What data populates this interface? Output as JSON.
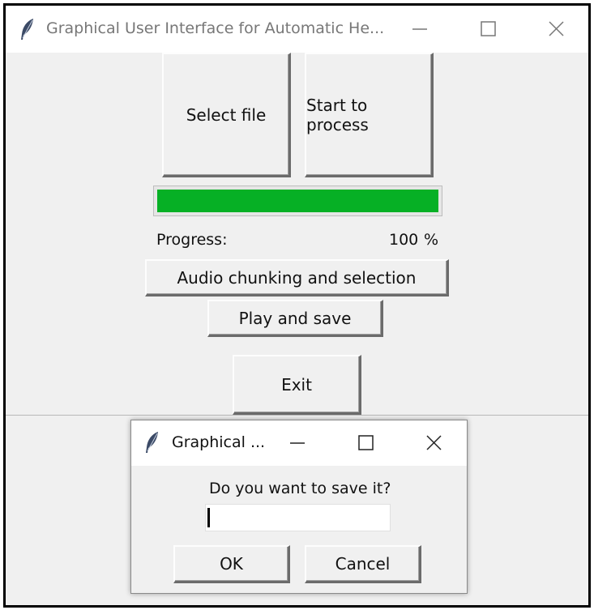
{
  "main_window": {
    "title": "Graphical User Interface for Automatic He...",
    "select_file_label": "Select file",
    "start_process_label": "Start to process",
    "progress": {
      "label": "Progress:",
      "value": 100,
      "value_text": "100",
      "unit": "%"
    },
    "audio_chunking_label": "Audio chunking and selection",
    "play_save_label": "Play and save",
    "exit_label": "Exit"
  },
  "dialog": {
    "title": "Graphical ...",
    "prompt": "Do you want to save it?",
    "input_value": "",
    "ok_label": "OK",
    "cancel_label": "Cancel"
  },
  "colors": {
    "progress_fill": "#06b025",
    "window_bg": "#f0f0f0",
    "titlebar_bg": "#ffffff"
  },
  "icons": [
    "feather-icon",
    "minimize-icon",
    "maximize-icon",
    "close-icon"
  ]
}
